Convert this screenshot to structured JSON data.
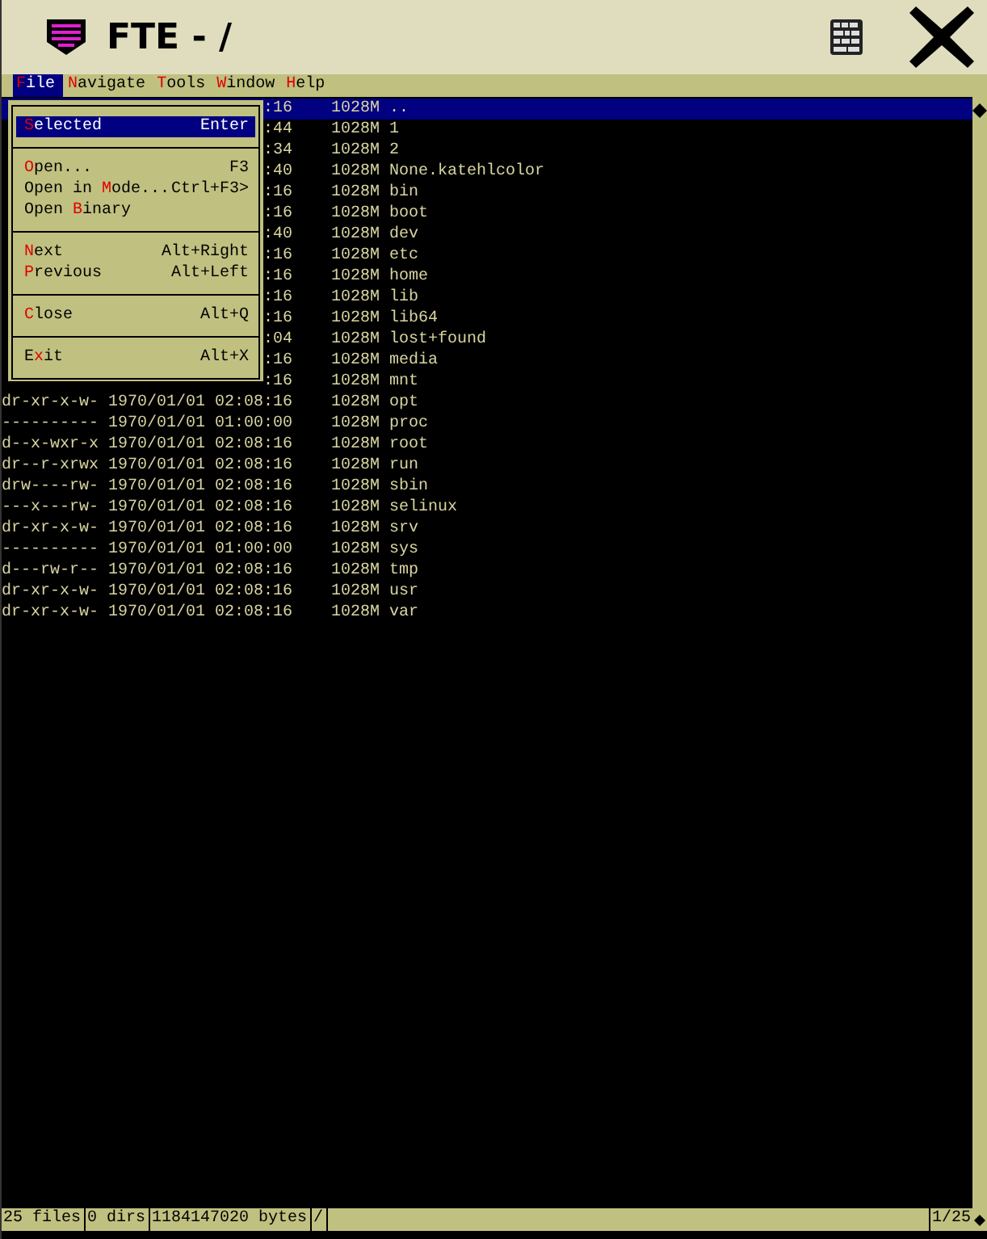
{
  "window": {
    "title": "FTE - /"
  },
  "menu_bar": [
    {
      "hotkey": "F",
      "rest": "ile",
      "selected": true
    },
    {
      "hotkey": "N",
      "rest": "avigate",
      "selected": false
    },
    {
      "hotkey": "T",
      "rest": "ools",
      "selected": false
    },
    {
      "hotkey": "W",
      "rest": "indow",
      "selected": false
    },
    {
      "hotkey": "H",
      "rest": "elp",
      "selected": false
    }
  ],
  "file_menu": [
    [
      {
        "hotkey": "S",
        "rest": "elected",
        "shortcut": "Enter",
        "selected": true
      }
    ],
    [
      {
        "hotkey": "O",
        "rest": "pen...",
        "shortcut": "F3",
        "selected": false
      },
      {
        "prefix": "Open in ",
        "hotkey": "M",
        "rest": "ode...",
        "shortcut": "Ctrl+F3>",
        "selected": false
      },
      {
        "prefix": "Open ",
        "hotkey": "B",
        "rest": "inary",
        "selected": false
      }
    ],
    [
      {
        "hotkey": "N",
        "rest": "ext",
        "shortcut": "Alt+Right",
        "selected": false
      },
      {
        "hotkey": "P",
        "rest": "revious",
        "shortcut": "Alt+Left",
        "selected": false
      }
    ],
    [
      {
        "hotkey": "C",
        "rest": "lose",
        "shortcut": "Alt+Q",
        "selected": false
      }
    ],
    [
      {
        "prefix": "E",
        "hotkey": "x",
        "rest": "it",
        "shortcut": "Alt+X",
        "selected": false
      }
    ]
  ],
  "listing": [
    {
      "info": ":16",
      "size": "1028M",
      "name": "..",
      "selected": true
    },
    {
      "info": ":44",
      "size": "1028M",
      "name": "1",
      "selected": false
    },
    {
      "info": ":34",
      "size": "1028M",
      "name": "2",
      "selected": false
    },
    {
      "info": ":40",
      "size": "1028M",
      "name": "None.katehlcolor",
      "selected": false
    },
    {
      "info": ":16",
      "size": "1028M",
      "name": "bin",
      "selected": false
    },
    {
      "info": ":16",
      "size": "1028M",
      "name": "boot",
      "selected": false
    },
    {
      "info": ":40",
      "size": "1028M",
      "name": "dev",
      "selected": false
    },
    {
      "info": ":16",
      "size": "1028M",
      "name": "etc",
      "selected": false
    },
    {
      "info": ":16",
      "size": "1028M",
      "name": "home",
      "selected": false
    },
    {
      "info": ":16",
      "size": "1028M",
      "name": "lib",
      "selected": false
    },
    {
      "info": ":16",
      "size": "1028M",
      "name": "lib64",
      "selected": false
    },
    {
      "info": ":04",
      "size": "1028M",
      "name": "lost+found",
      "selected": false
    },
    {
      "info": ":16",
      "size": "1028M",
      "name": "media",
      "selected": false
    },
    {
      "info": ":16",
      "size": "1028M",
      "name": "mnt",
      "selected": false
    },
    {
      "info": "dr-xr-x-w- 1970/01/01 02:08:16",
      "size": "1028M",
      "name": "opt",
      "selected": false
    },
    {
      "info": "---------- 1970/01/01 01:00:00",
      "size": "1028M",
      "name": "proc",
      "selected": false
    },
    {
      "info": "d--x-wxr-x 1970/01/01 02:08:16",
      "size": "1028M",
      "name": "root",
      "selected": false
    },
    {
      "info": "dr--r-xrwx 1970/01/01 02:08:16",
      "size": "1028M",
      "name": "run",
      "selected": false
    },
    {
      "info": "drw----rw- 1970/01/01 02:08:16",
      "size": "1028M",
      "name": "sbin",
      "selected": false
    },
    {
      "info": "---x---rw- 1970/01/01 02:08:16",
      "size": "1028M",
      "name": "selinux",
      "selected": false
    },
    {
      "info": "dr-xr-x-w- 1970/01/01 02:08:16",
      "size": "1028M",
      "name": "srv",
      "selected": false
    },
    {
      "info": "---------- 1970/01/01 01:00:00",
      "size": "1028M",
      "name": "sys",
      "selected": false
    },
    {
      "info": "d---rw-r-- 1970/01/01 02:08:16",
      "size": "1028M",
      "name": "tmp",
      "selected": false
    },
    {
      "info": "dr-xr-x-w- 1970/01/01 02:08:16",
      "size": "1028M",
      "name": "usr",
      "selected": false
    },
    {
      "info": "dr-xr-x-w- 1970/01/01 02:08:16",
      "size": "1028M",
      "name": "var",
      "selected": false
    }
  ],
  "status_bar": {
    "fields": [
      "25 files",
      "0 dirs",
      "1184147020 bytes",
      "/"
    ],
    "position": "1/25"
  }
}
